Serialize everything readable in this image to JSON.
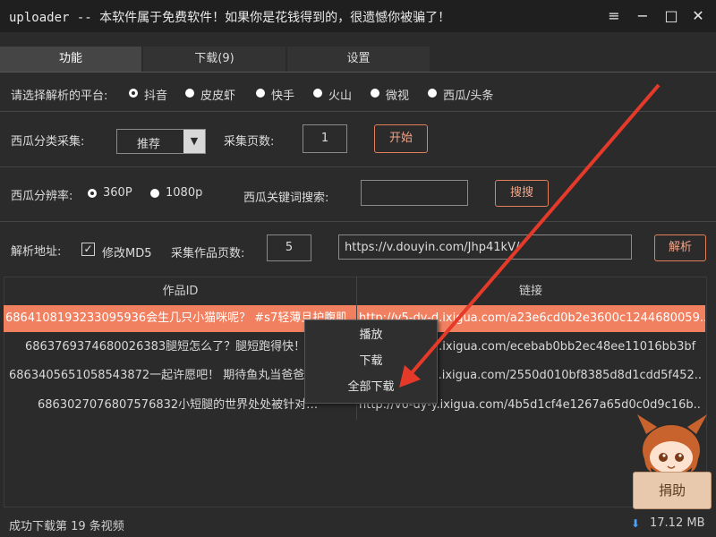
{
  "window": {
    "title": "uploader -- 本软件属于免费软件！如果你是花钱得到的，很遗憾你被骗了！"
  },
  "tabs": [
    {
      "label": "功能",
      "active": true
    },
    {
      "label": "下载(9)",
      "active": false
    },
    {
      "label": "设置",
      "active": false
    }
  ],
  "platform": {
    "label": "请选择解析的平台:",
    "options": [
      "抖音",
      "皮皮虾",
      "快手",
      "火山",
      "微视",
      "西瓜/头条"
    ],
    "selected": "抖音"
  },
  "xigua_category": {
    "label": "西瓜分类采集:",
    "dropdown_value": "推荐",
    "pages_label": "采集页数:",
    "pages_value": "1",
    "start_label": "开始"
  },
  "xigua_resolution": {
    "label": "西瓜分辨率:",
    "options": [
      "360P",
      "1080p"
    ],
    "selected": "360P",
    "search_label": "西瓜关键词搜索:",
    "search_value": "",
    "search_button": "搜搜"
  },
  "parse": {
    "label": "解析地址:",
    "md5_label": "修改MD5",
    "md5_checked": true,
    "pages_label": "采集作品页数:",
    "pages_value": "5",
    "url_value": "https://v.douyin.com/Jhp41kV/",
    "parse_button": "解析"
  },
  "table": {
    "headers": [
      "作品ID",
      "链接"
    ],
    "rows": [
      {
        "id": "6864108193233095936会生几只小猫咪呢？ #s7轻薄旦护腹肌",
        "link": "http://v5-dy-d.ixigua.com/a23e6cd0b2e3600c1244680059..",
        "selected": true
      },
      {
        "id": "6863769374680026383腿短怎么了？腿短跑得快！",
        "link": "http://v5-dy-d.ixigua.com/ecebab0bb2ec48ee11016bb3bf",
        "selected": false
      },
      {
        "id": "6863405651058543872一起许愿吧！ 期待鱼丸当爸爸",
        "link": "http://v5-dy-x.ixigua.com/2550d010bf8385d8d1cdd5f452..",
        "selected": false
      },
      {
        "id": "6863027076807576832小短腿的世界处处被针对…",
        "link": "http://v6-dy-y.ixigua.com/4b5d1cf4e1267a65d0c0d9c16b..",
        "selected": false
      }
    ]
  },
  "context_menu": {
    "items": [
      "播放",
      "下载",
      "全部下载"
    ]
  },
  "donate": {
    "label": "捐助"
  },
  "status": {
    "message": "成功下载第 19 条视频",
    "size": "17.12 MB"
  },
  "colors": {
    "accent": "#f07e5a",
    "selected_row": "#f08060",
    "annotation_arrow": "#e53a2a"
  }
}
